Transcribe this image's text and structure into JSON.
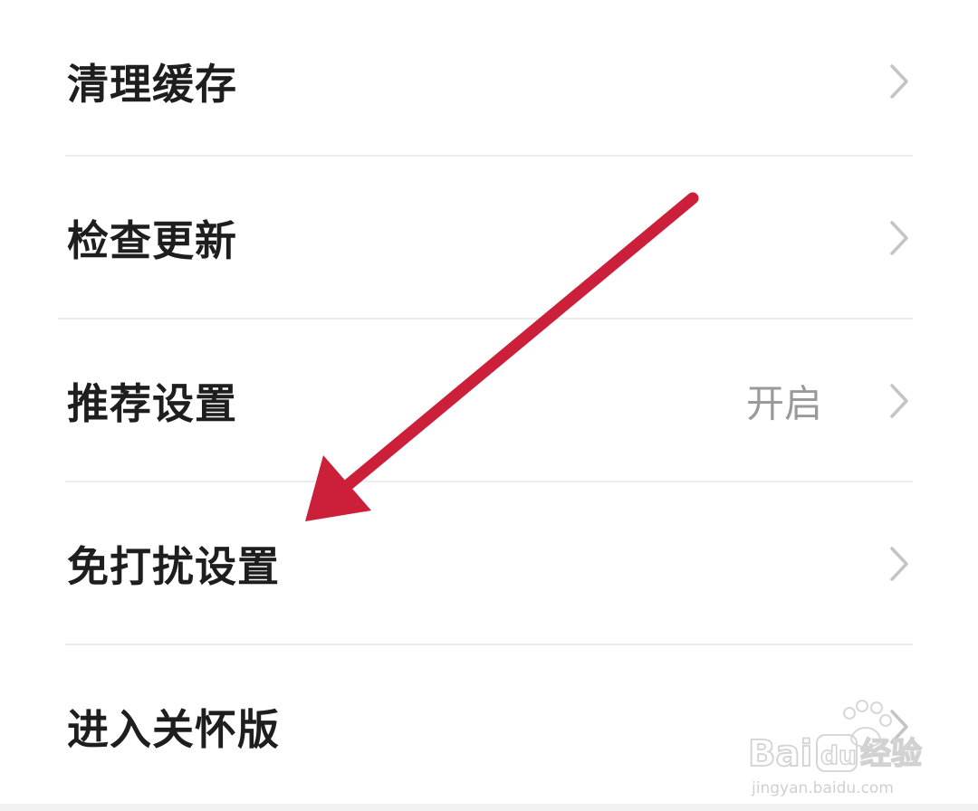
{
  "settings": {
    "items": [
      {
        "label": "清理缓存",
        "value": ""
      },
      {
        "label": "检查更新",
        "value": ""
      },
      {
        "label": "推荐设置",
        "value": "开启"
      },
      {
        "label": "免打扰设置",
        "value": ""
      },
      {
        "label": "进入关怀版",
        "value": ""
      }
    ]
  },
  "annotation": {
    "arrow_color": "#cc1f3a",
    "target_item": "免打扰设置"
  },
  "watermark": {
    "brand": "Bai du 经验",
    "url": "jingyan.baidu.com"
  }
}
